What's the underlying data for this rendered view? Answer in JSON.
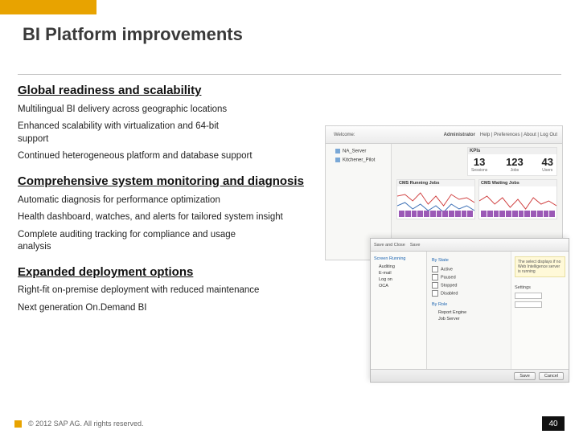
{
  "slide": {
    "title": "BI Platform improvements"
  },
  "sections": [
    {
      "heading": "Global readiness and scalability",
      "bullets": [
        "Multilingual BI delivery across geographic locations",
        "Enhanced scalability with virtualization and 64-bit support",
        "Continued heterogeneous platform and database support"
      ]
    },
    {
      "heading": "Comprehensive system monitoring and diagnosis",
      "bullets": [
        "Automatic diagnosis for performance optimization",
        "Health dashboard, watches, and alerts for tailored system insight",
        "Complete auditing tracking for compliance and usage analysis"
      ]
    },
    {
      "heading": "Expanded deployment options",
      "bullets": [
        "Right-fit on-premise deployment with reduced maintenance",
        "Next generation On.Demand BI"
      ]
    }
  ],
  "figure1": {
    "welcome": "Welcome:",
    "admin": "Administrator",
    "links": "Help | Preferences | About | Log Out",
    "tree": [
      "NA_Server",
      "Kitchener_Pilot"
    ],
    "kpi_title": "KPIs",
    "kpis": [
      {
        "num": "13",
        "label": "Sessions"
      },
      {
        "num": "123",
        "label": "Jobs"
      },
      {
        "num": "43",
        "label": "Users"
      }
    ],
    "chart1_title": "CMS Running Jobs",
    "chart2_title": "CMS Waiting Jobs"
  },
  "figure2": {
    "head_items": [
      "Save and Close",
      "Save"
    ],
    "left_title": "Screen Running",
    "left_items": [
      "Auditing",
      "E-mail",
      "Log on",
      "OCA"
    ],
    "panel_label_1": "By State",
    "checks": [
      "Active",
      "Paused",
      "Stopped",
      "Disabled"
    ],
    "panel_label_2": "By Role",
    "rows": [
      "Report Engine",
      "Job Server"
    ],
    "note": "The select displays if no Web Intelligence server is running",
    "fields_label": "Settings",
    "buttons": [
      "Save",
      "Cancel"
    ]
  },
  "footer": {
    "copyright": "© 2012 SAP AG. All rights reserved.",
    "page": "40"
  }
}
